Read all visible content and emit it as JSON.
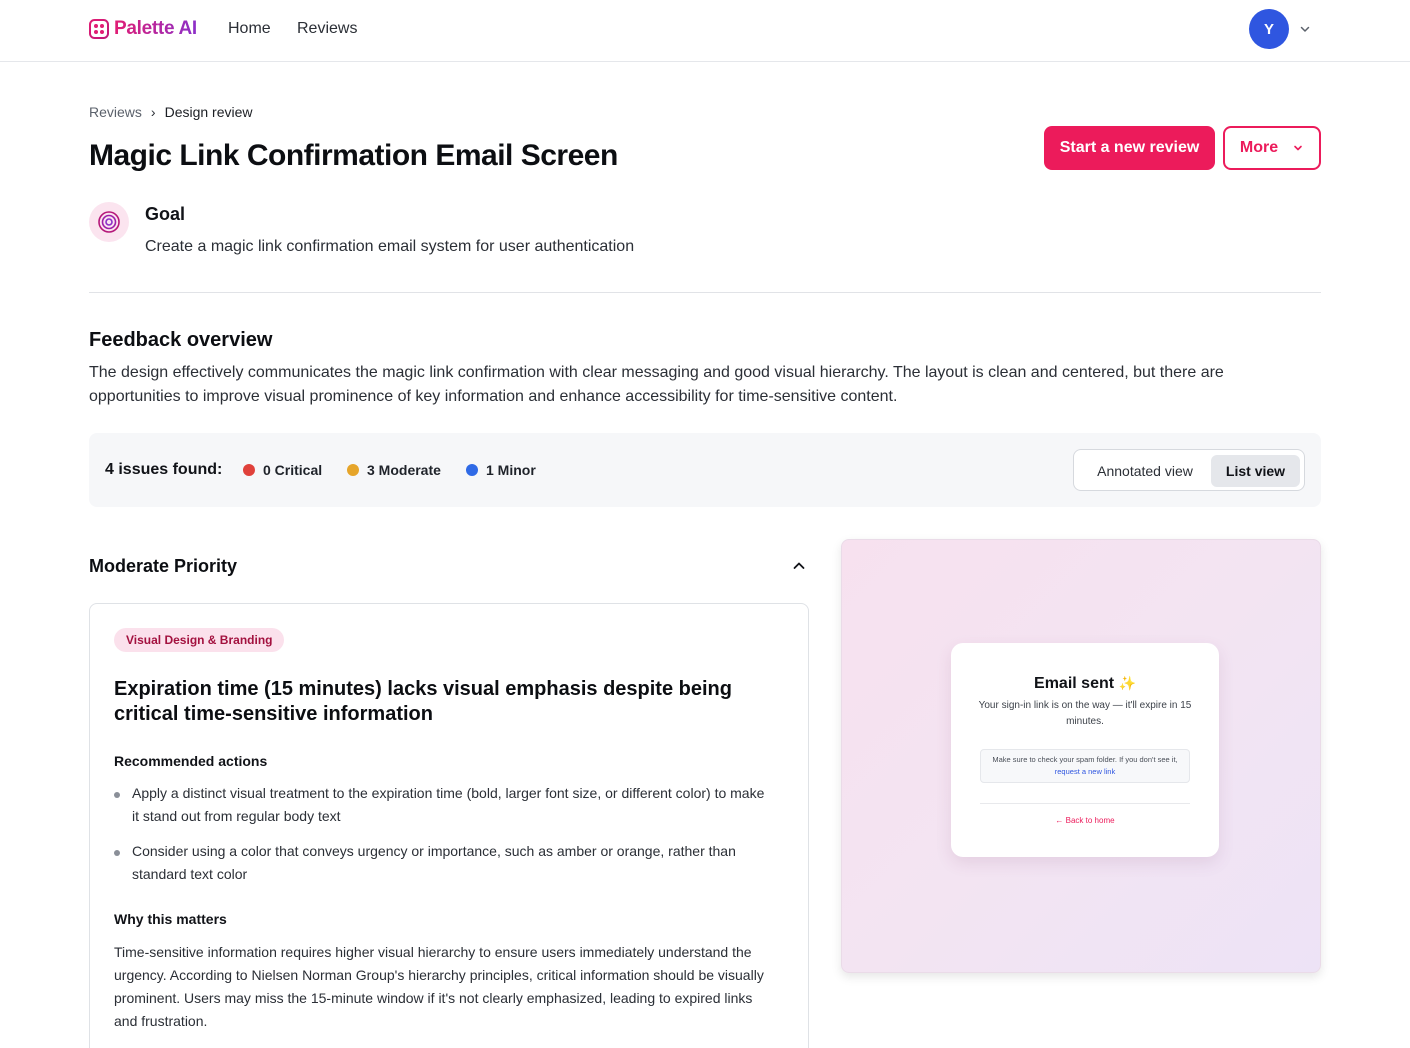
{
  "nav": {
    "brand": "Palette AI",
    "links": [
      "Home",
      "Reviews"
    ],
    "avatar_initial": "Y",
    "brand_colors": [
      "#e11d74",
      "#8b2fc9"
    ]
  },
  "breadcrumb": {
    "parent": "Reviews",
    "separator": "›",
    "current": "Design review"
  },
  "page": {
    "title": "Magic Link Confirmation Email Screen",
    "primary_action": "Start a new review",
    "more_action": "More",
    "accent_color": "#ec1b5b"
  },
  "goal": {
    "label": "Goal",
    "text": "Create a magic link confirmation email system for user authentication",
    "icon": "target-icon"
  },
  "feedback_overview": {
    "title": "Feedback overview",
    "text": "The design effectively communicates the magic link confirmation with clear messaging and good visual hierarchy. The layout is clean and centered, but there are opportunities to improve visual prominence of key information and enhance accessibility for time-sensitive content."
  },
  "issues": {
    "summary": "4 issues found:",
    "severities": [
      {
        "label": "0 Critical",
        "color": "#e0413b"
      },
      {
        "label": "3 Moderate",
        "color": "#e6a52a"
      },
      {
        "label": "1 Minor",
        "color": "#2f6ae6"
      }
    ],
    "views": [
      "Annotated view",
      "List view"
    ],
    "active_view": "List view"
  },
  "section": {
    "title": "Moderate Priority",
    "expanded": true
  },
  "issue_card": {
    "tag": "Visual Design & Branding",
    "title": "Expiration time (15 minutes) lacks visual emphasis despite being critical time-sensitive information",
    "recommended_label": "Recommended actions",
    "actions": [
      "Apply a distinct visual treatment to the expiration time (bold, larger font size, or different color) to make it stand out from regular body text",
      "Consider using a color that conveys urgency or importance, such as amber or orange, rather than standard text color"
    ],
    "why_label": "Why this matters",
    "why_text": "Time-sensitive information requires higher visual hierarchy to ensure users immediately understand the urgency. According to Nielsen Norman Group's hierarchy principles, critical information should be visually prominent. Users may miss the 15-minute window if it's not clearly emphasized, leading to expired links and frustration."
  },
  "preview": {
    "title": "Email sent",
    "sparkle": "✨",
    "subtitle": "Your sign-in link is on the way — it'll expire in 15 minutes.",
    "note_prefix": "Make sure to check your spam folder. If you don't see it,",
    "note_link": "request a new link",
    "back_link": "← Back to home"
  }
}
